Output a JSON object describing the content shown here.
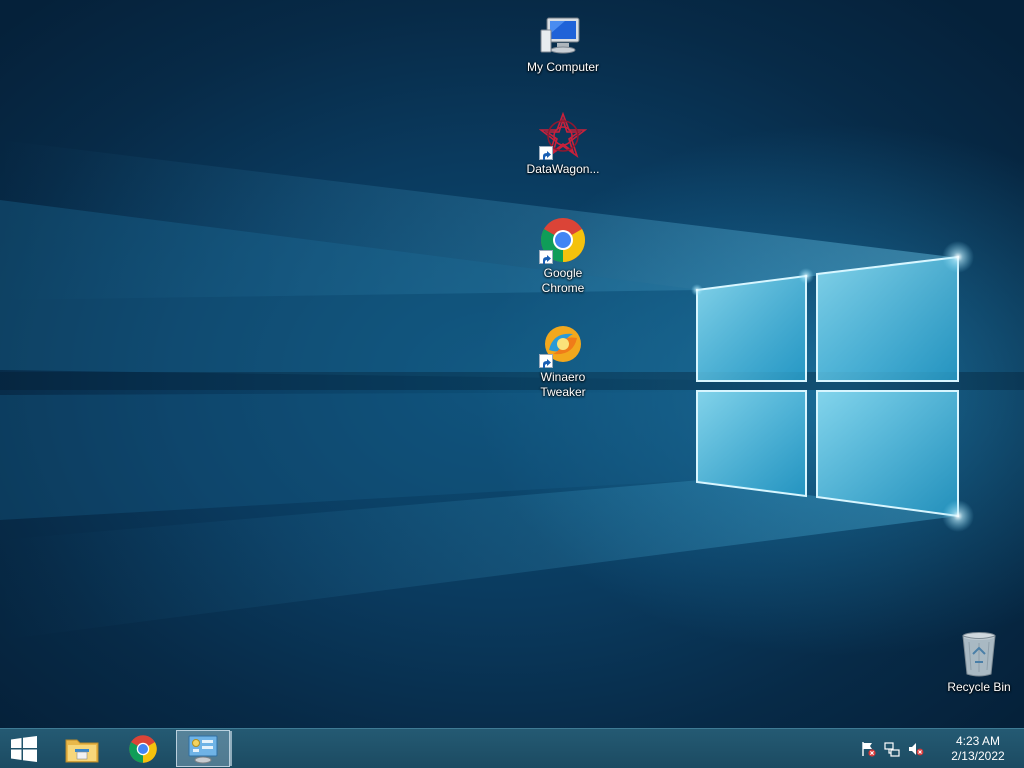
{
  "desktop": {
    "icons": [
      {
        "label": "My Computer",
        "icon": "computer-icon",
        "shortcut": false
      },
      {
        "label": "DataWagon...",
        "icon": "datawagon-icon",
        "shortcut": true
      },
      {
        "label": "Google\nChrome",
        "icon": "chrome-icon",
        "shortcut": true
      },
      {
        "label": "Winaero\nTweaker",
        "icon": "winaero-tweaker-icon",
        "shortcut": true
      },
      {
        "label": "Recycle Bin",
        "icon": "recycle-bin-icon",
        "shortcut": false
      }
    ]
  },
  "taskbar": {
    "start": {
      "icon": "windows-logo-icon"
    },
    "pinned": [
      {
        "icon": "file-explorer-icon",
        "active": false
      },
      {
        "icon": "chrome-icon",
        "active": false
      },
      {
        "icon": "control-panel-icon",
        "active": true
      }
    ],
    "tray": {
      "icons": [
        "action-center-flag-icon",
        "network-icon",
        "volume-muted-icon"
      ],
      "time": "4:23 AM",
      "date": "2/13/2022"
    }
  },
  "colors": {
    "taskbar": "#245a73",
    "desktop_dark": "#05213a",
    "desktop_light": "#2a96c8",
    "label_text": "#ffffff"
  }
}
